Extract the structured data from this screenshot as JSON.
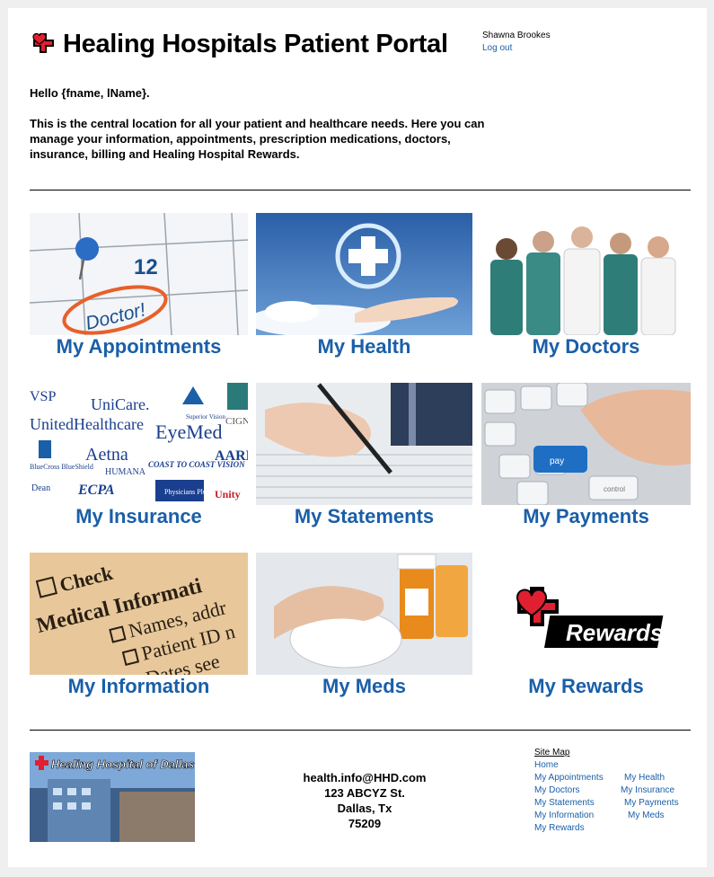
{
  "header": {
    "title": "Healing Hospitals Patient Portal",
    "user_name": "Shawna Brookes",
    "logout": "Log out"
  },
  "intro": {
    "greeting": "Hello {fname, lName}.",
    "text": "This is the central location for all your patient and healthcare needs. Here you can manage your information, appointments, prescription medications, doctors, insurance, billing and Healing Hospital Rewards."
  },
  "tiles": {
    "appointments": {
      "label": "My Appointments",
      "img_text": "12",
      "img_text2": "Doctor!"
    },
    "health": {
      "label": "My Health"
    },
    "doctors": {
      "label": "My Doctors"
    },
    "insurance": {
      "label": "My Insurance",
      "logos": [
        "UniCare.",
        "UnitedHealthcare",
        "EyeMed",
        "Aetna",
        "HUMANA",
        "COAST TO COAST VISION",
        "AARP",
        "Superior Vision",
        "CIGNA",
        "BlueCross BlueShield",
        "Dean",
        "ECPA",
        "Physicians Plus",
        "Unity",
        "VSP"
      ]
    },
    "statements": {
      "label": "My Statements"
    },
    "payments": {
      "label": "My Payments",
      "key_text": "pay",
      "key_text2": "control"
    },
    "information": {
      "label": "My Information",
      "img_lines": [
        "Check",
        "Medical Informati",
        "Names, addr",
        "Patient ID n",
        "Dates see"
      ]
    },
    "meds": {
      "label": "My Meds"
    },
    "rewards": {
      "label": "My Rewards",
      "logo_text": "Rewards"
    }
  },
  "footer": {
    "image_text": "Healing Hospital of Dallas",
    "email": "health.info@HHD.com",
    "street": "123 ABCYZ St.",
    "city": "Dallas, Tx",
    "zip": "75209"
  },
  "sitemap": {
    "title": "Site Map",
    "home": "Home",
    "appointments": "My Appointments",
    "health": "My Health",
    "doctors": "My Doctors",
    "insurance": "My Insurance",
    "statements": "My Statements",
    "payments": "My Payments",
    "information": "My Information",
    "meds": "My Meds",
    "rewards": "My Rewards"
  },
  "colors": {
    "link_blue": "#1a5fa8",
    "brand_red": "#e02030"
  }
}
